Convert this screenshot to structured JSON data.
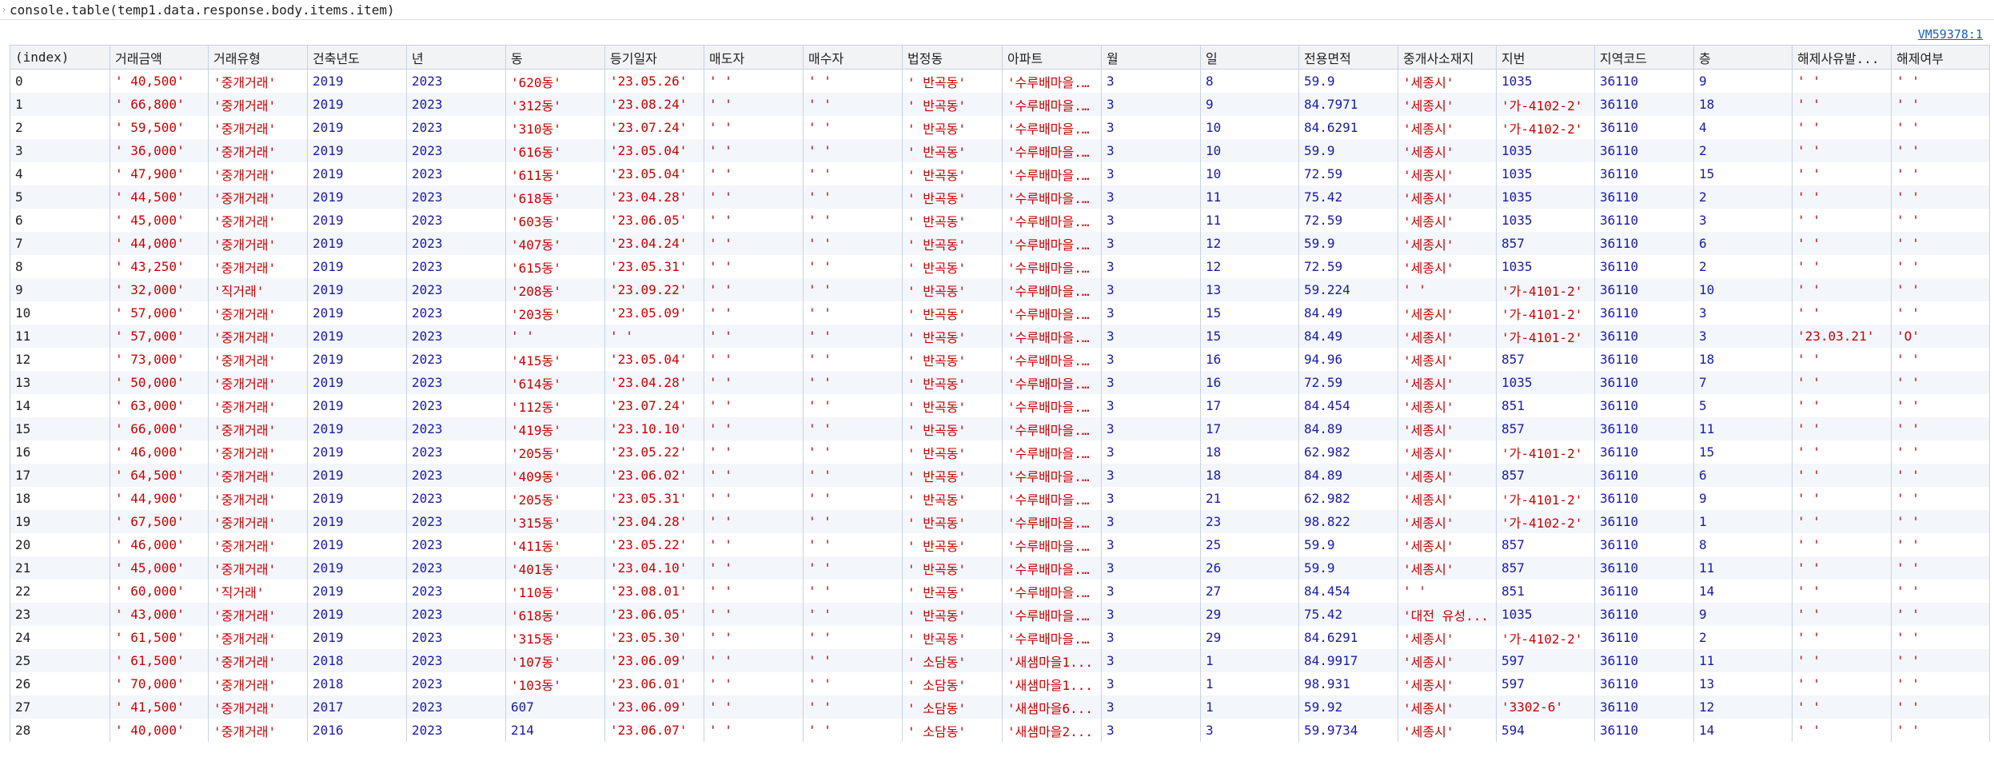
{
  "console": {
    "command": "console.table(temp1.data.response.body.items.item)",
    "source_link": "VM59378:1"
  },
  "table": {
    "columns": [
      "(index)",
      "거래금액",
      "거래유형",
      "건축년도",
      "년",
      "동",
      "등기일자",
      "매도자",
      "매수자",
      "법정동",
      "아파트",
      "월",
      "일",
      "전용면적",
      "중개사소재지",
      "지번",
      "지역코드",
      "층",
      "해제사유발...",
      "해제여부"
    ],
    "rows": [
      [
        "0",
        "' 40,500'",
        "'중개거래'",
        "2019",
        "2023",
        "'620동'",
        "'23.05.26'",
        "' '",
        "' '",
        "' 반곡동'",
        "'수루배마을...",
        "3",
        "8",
        "59.9",
        "'세종시'",
        "1035",
        "36110",
        "9",
        "' '",
        "' '"
      ],
      [
        "1",
        "' 66,800'",
        "'중개거래'",
        "2019",
        "2023",
        "'312동'",
        "'23.08.24'",
        "' '",
        "' '",
        "' 반곡동'",
        "'수루배마을...",
        "3",
        "9",
        "84.7971",
        "'세종시'",
        "'가-4102-2'",
        "36110",
        "18",
        "' '",
        "' '"
      ],
      [
        "2",
        "' 59,500'",
        "'중개거래'",
        "2019",
        "2023",
        "'310동'",
        "'23.07.24'",
        "' '",
        "' '",
        "' 반곡동'",
        "'수루배마을...",
        "3",
        "10",
        "84.6291",
        "'세종시'",
        "'가-4102-2'",
        "36110",
        "4",
        "' '",
        "' '"
      ],
      [
        "3",
        "' 36,000'",
        "'중개거래'",
        "2019",
        "2023",
        "'616동'",
        "'23.05.04'",
        "' '",
        "' '",
        "' 반곡동'",
        "'수루배마을...",
        "3",
        "10",
        "59.9",
        "'세종시'",
        "1035",
        "36110",
        "2",
        "' '",
        "' '"
      ],
      [
        "4",
        "' 47,900'",
        "'중개거래'",
        "2019",
        "2023",
        "'611동'",
        "'23.05.04'",
        "' '",
        "' '",
        "' 반곡동'",
        "'수루배마을...",
        "3",
        "10",
        "72.59",
        "'세종시'",
        "1035",
        "36110",
        "15",
        "' '",
        "' '"
      ],
      [
        "5",
        "' 44,500'",
        "'중개거래'",
        "2019",
        "2023",
        "'618동'",
        "'23.04.28'",
        "' '",
        "' '",
        "' 반곡동'",
        "'수루배마을...",
        "3",
        "11",
        "75.42",
        "'세종시'",
        "1035",
        "36110",
        "2",
        "' '",
        "' '"
      ],
      [
        "6",
        "' 45,000'",
        "'중개거래'",
        "2019",
        "2023",
        "'603동'",
        "'23.06.05'",
        "' '",
        "' '",
        "' 반곡동'",
        "'수루배마을...",
        "3",
        "11",
        "72.59",
        "'세종시'",
        "1035",
        "36110",
        "3",
        "' '",
        "' '"
      ],
      [
        "7",
        "' 44,000'",
        "'중개거래'",
        "2019",
        "2023",
        "'407동'",
        "'23.04.24'",
        "' '",
        "' '",
        "' 반곡동'",
        "'수루배마을...",
        "3",
        "12",
        "59.9",
        "'세종시'",
        "857",
        "36110",
        "6",
        "' '",
        "' '"
      ],
      [
        "8",
        "' 43,250'",
        "'중개거래'",
        "2019",
        "2023",
        "'615동'",
        "'23.05.31'",
        "' '",
        "' '",
        "' 반곡동'",
        "'수루배마을...",
        "3",
        "12",
        "72.59",
        "'세종시'",
        "1035",
        "36110",
        "2",
        "' '",
        "' '"
      ],
      [
        "9",
        "' 32,000'",
        "'직거래'",
        "2019",
        "2023",
        "'208동'",
        "'23.09.22'",
        "' '",
        "' '",
        "' 반곡동'",
        "'수루배마을...",
        "3",
        "13",
        "59.224",
        "' '",
        "'가-4101-2'",
        "36110",
        "10",
        "' '",
        "' '"
      ],
      [
        "10",
        "' 57,000'",
        "'중개거래'",
        "2019",
        "2023",
        "'203동'",
        "'23.05.09'",
        "' '",
        "' '",
        "' 반곡동'",
        "'수루배마을...",
        "3",
        "15",
        "84.49",
        "'세종시'",
        "'가-4101-2'",
        "36110",
        "3",
        "' '",
        "' '"
      ],
      [
        "11",
        "' 57,000'",
        "'중개거래'",
        "2019",
        "2023",
        "' '",
        "' '",
        "' '",
        "' '",
        "' 반곡동'",
        "'수루배마을...",
        "3",
        "15",
        "84.49",
        "'세종시'",
        "'가-4101-2'",
        "36110",
        "3",
        "'23.03.21'",
        "'O'"
      ],
      [
        "12",
        "' 73,000'",
        "'중개거래'",
        "2019",
        "2023",
        "'415동'",
        "'23.05.04'",
        "' '",
        "' '",
        "' 반곡동'",
        "'수루배마을...",
        "3",
        "16",
        "94.96",
        "'세종시'",
        "857",
        "36110",
        "18",
        "' '",
        "' '"
      ],
      [
        "13",
        "' 50,000'",
        "'중개거래'",
        "2019",
        "2023",
        "'614동'",
        "'23.04.28'",
        "' '",
        "' '",
        "' 반곡동'",
        "'수루배마을...",
        "3",
        "16",
        "72.59",
        "'세종시'",
        "1035",
        "36110",
        "7",
        "' '",
        "' '"
      ],
      [
        "14",
        "' 63,000'",
        "'중개거래'",
        "2019",
        "2023",
        "'112동'",
        "'23.07.24'",
        "' '",
        "' '",
        "' 반곡동'",
        "'수루배마을...",
        "3",
        "17",
        "84.454",
        "'세종시'",
        "851",
        "36110",
        "5",
        "' '",
        "' '"
      ],
      [
        "15",
        "' 66,000'",
        "'중개거래'",
        "2019",
        "2023",
        "'419동'",
        "'23.10.10'",
        "' '",
        "' '",
        "' 반곡동'",
        "'수루배마을...",
        "3",
        "17",
        "84.89",
        "'세종시'",
        "857",
        "36110",
        "11",
        "' '",
        "' '"
      ],
      [
        "16",
        "' 46,000'",
        "'중개거래'",
        "2019",
        "2023",
        "'205동'",
        "'23.05.22'",
        "' '",
        "' '",
        "' 반곡동'",
        "'수루배마을...",
        "3",
        "18",
        "62.982",
        "'세종시'",
        "'가-4101-2'",
        "36110",
        "15",
        "' '",
        "' '"
      ],
      [
        "17",
        "' 64,500'",
        "'중개거래'",
        "2019",
        "2023",
        "'409동'",
        "'23.06.02'",
        "' '",
        "' '",
        "' 반곡동'",
        "'수루배마을...",
        "3",
        "18",
        "84.89",
        "'세종시'",
        "857",
        "36110",
        "6",
        "' '",
        "' '"
      ],
      [
        "18",
        "' 44,900'",
        "'중개거래'",
        "2019",
        "2023",
        "'205동'",
        "'23.05.31'",
        "' '",
        "' '",
        "' 반곡동'",
        "'수루배마을...",
        "3",
        "21",
        "62.982",
        "'세종시'",
        "'가-4101-2'",
        "36110",
        "9",
        "' '",
        "' '"
      ],
      [
        "19",
        "' 67,500'",
        "'중개거래'",
        "2019",
        "2023",
        "'315동'",
        "'23.04.28'",
        "' '",
        "' '",
        "' 반곡동'",
        "'수루배마을...",
        "3",
        "23",
        "98.822",
        "'세종시'",
        "'가-4102-2'",
        "36110",
        "1",
        "' '",
        "' '"
      ],
      [
        "20",
        "' 46,000'",
        "'중개거래'",
        "2019",
        "2023",
        "'411동'",
        "'23.05.22'",
        "' '",
        "' '",
        "' 반곡동'",
        "'수루배마을...",
        "3",
        "25",
        "59.9",
        "'세종시'",
        "857",
        "36110",
        "8",
        "' '",
        "' '"
      ],
      [
        "21",
        "' 45,000'",
        "'중개거래'",
        "2019",
        "2023",
        "'401동'",
        "'23.04.10'",
        "' '",
        "' '",
        "' 반곡동'",
        "'수루배마을...",
        "3",
        "26",
        "59.9",
        "'세종시'",
        "857",
        "36110",
        "11",
        "' '",
        "' '"
      ],
      [
        "22",
        "' 60,000'",
        "'직거래'",
        "2019",
        "2023",
        "'110동'",
        "'23.08.01'",
        "' '",
        "' '",
        "' 반곡동'",
        "'수루배마을...",
        "3",
        "27",
        "84.454",
        "' '",
        "851",
        "36110",
        "14",
        "' '",
        "' '"
      ],
      [
        "23",
        "' 43,000'",
        "'중개거래'",
        "2019",
        "2023",
        "'618동'",
        "'23.06.05'",
        "' '",
        "' '",
        "' 반곡동'",
        "'수루배마을...",
        "3",
        "29",
        "75.42",
        "'대전 유성...",
        "1035",
        "36110",
        "9",
        "' '",
        "' '"
      ],
      [
        "24",
        "' 61,500'",
        "'중개거래'",
        "2019",
        "2023",
        "'315동'",
        "'23.05.30'",
        "' '",
        "' '",
        "' 반곡동'",
        "'수루배마을...",
        "3",
        "29",
        "84.6291",
        "'세종시'",
        "'가-4102-2'",
        "36110",
        "2",
        "' '",
        "' '"
      ],
      [
        "25",
        "' 61,500'",
        "'중개거래'",
        "2018",
        "2023",
        "'107동'",
        "'23.06.09'",
        "' '",
        "' '",
        "' 소담동'",
        "'새샘마을1...",
        "3",
        "1",
        "84.9917",
        "'세종시'",
        "597",
        "36110",
        "11",
        "' '",
        "' '"
      ],
      [
        "26",
        "' 70,000'",
        "'중개거래'",
        "2018",
        "2023",
        "'103동'",
        "'23.06.01'",
        "' '",
        "' '",
        "' 소담동'",
        "'새샘마을1...",
        "3",
        "1",
        "98.931",
        "'세종시'",
        "597",
        "36110",
        "13",
        "' '",
        "' '"
      ],
      [
        "27",
        "' 41,500'",
        "'중개거래'",
        "2017",
        "2023",
        "607",
        "'23.06.09'",
        "' '",
        "' '",
        "' 소담동'",
        "'새샘마을6...",
        "3",
        "1",
        "59.92",
        "'세종시'",
        "'3302-6'",
        "36110",
        "12",
        "' '",
        "' '"
      ],
      [
        "28",
        "' 40,000'",
        "'중개거래'",
        "2016",
        "2023",
        "214",
        "'23.06.07'",
        "' '",
        "' '",
        "' 소담동'",
        "'새샘마을2...",
        "3",
        "3",
        "59.9734",
        "'세종시'",
        "594",
        "36110",
        "14",
        "' '",
        "' '"
      ]
    ]
  },
  "colors": {
    "string": "#c80000",
    "number": "#1a1aa6",
    "link": "#1a5fb4",
    "header_bg": "#f1f3f4",
    "stripe_bg": "#f3f6fb",
    "border": "#c7d2e3"
  }
}
